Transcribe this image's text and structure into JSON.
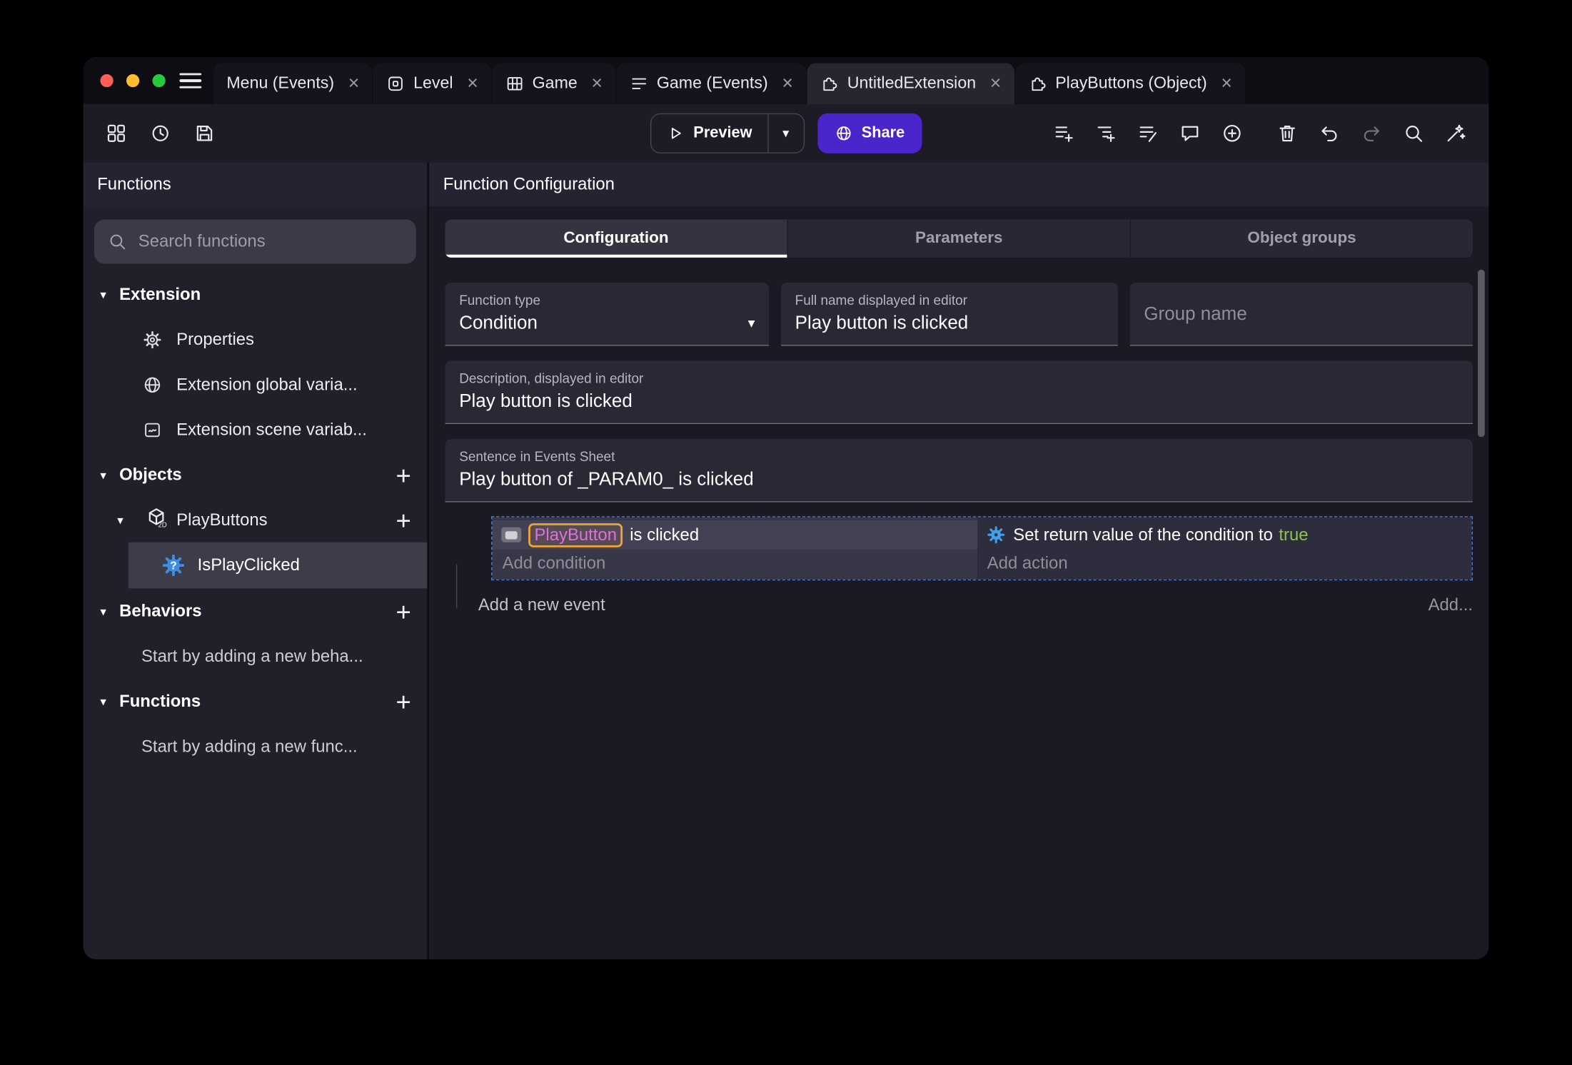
{
  "glyphs": {
    "close": "×",
    "chevron_down": "▾",
    "plus": "+",
    "question": "?",
    "cube_2d_label": "2D"
  },
  "colors": {
    "accent": "#4a25cb",
    "selection_blue": "#4a7fd0",
    "object_chip_border": "#eea33c",
    "object_chip_text": "#df6ee0",
    "true_green": "#8ec24d"
  },
  "tabbar": {
    "tabs": [
      {
        "label": "Menu (Events)"
      },
      {
        "label": "Level"
      },
      {
        "label": "Game"
      },
      {
        "label": "Game (Events)"
      },
      {
        "label": "UntitledExtension"
      },
      {
        "label": "PlayButtons (Object)"
      }
    ]
  },
  "toolbar": {
    "preview_label": "Preview",
    "share_label": "Share"
  },
  "sidebar": {
    "title": "Functions",
    "search_placeholder": "Search functions",
    "extension": {
      "label": "Extension",
      "items": [
        {
          "label": "Properties"
        },
        {
          "label": "Extension global varia..."
        },
        {
          "label": "Extension scene variab..."
        }
      ]
    },
    "objects": {
      "label": "Objects",
      "object_label": "PlayButtons",
      "function_label": "IsPlayClicked"
    },
    "behaviors": {
      "label": "Behaviors",
      "empty_label": "Start by adding a new beha..."
    },
    "functions": {
      "label": "Functions",
      "empty_label": "Start by adding a new func..."
    }
  },
  "main": {
    "title": "Function Configuration",
    "tabs": [
      {
        "label": "Configuration"
      },
      {
        "label": "Parameters"
      },
      {
        "label": "Object groups"
      }
    ],
    "form": {
      "function_type": {
        "label": "Function type",
        "value": "Condition"
      },
      "full_name": {
        "label": "Full name displayed in editor",
        "value": "Play button is clicked"
      },
      "group_name": {
        "placeholder": "Group name"
      },
      "description": {
        "label": "Description, displayed in editor",
        "value": "Play button is clicked"
      },
      "sentence": {
        "label": "Sentence in Events Sheet",
        "value": "Play button of _PARAM0_ is clicked"
      }
    },
    "events": {
      "condition": {
        "object_name": "PlayButton",
        "suffix": "is clicked",
        "add_label": "Add condition"
      },
      "action": {
        "prefix": "Set return value of the condition to",
        "value": "true",
        "add_label": "Add action"
      },
      "add_event_label": "Add a new event",
      "add_more_label": "Add..."
    }
  }
}
